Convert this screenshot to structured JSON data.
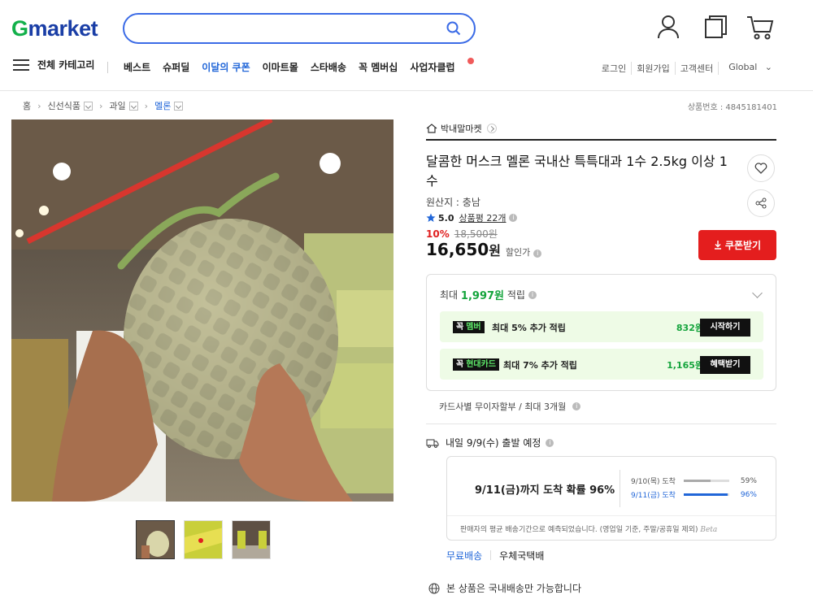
{
  "header": {
    "logo_g": "G",
    "logo_rest": "market",
    "search_placeholder": "",
    "category_label": "전체 카테고리",
    "nav": [
      "베스트",
      "슈퍼딜",
      "이달의 쿠폰",
      "이마트몰",
      "스타배송",
      "꼭 멤버십",
      "사업자클럽"
    ],
    "util": [
      "로그인",
      "회원가입",
      "고객센터",
      "Global"
    ]
  },
  "breadcrumb": [
    "홈",
    "신선식품",
    "과일",
    "멜론"
  ],
  "product_number": "상품번호 : 4845181401",
  "seller": "박내말마켓",
  "title": "달콤한 머스크 멜론 국내산 특특대과 1수 2.5kg 이상 1수",
  "origin": "원산지 : 충남",
  "rating": {
    "score": "5.0",
    "reviews": "상품평 22개"
  },
  "discount": {
    "percent": "10%",
    "original": "18,500원"
  },
  "price": {
    "amount": "16,650",
    "unit": "원",
    "label": "할인가"
  },
  "coupon_button": "쿠폰받기",
  "points": {
    "prefix": "최대",
    "amount": "1,997원",
    "suffix": "적립",
    "rows": [
      {
        "badge1": "꼭",
        "badge2": "멤버",
        "text": "최대 5% 추가 적립",
        "amount": "832원",
        "button": "시작하기"
      },
      {
        "badge1": "꼭",
        "badge2": "현대카드",
        "text": "최대 7% 추가 적립",
        "amount": "1,165원",
        "button": "혜택받기"
      }
    ]
  },
  "installment": "카드사별 무이자할부 / 최대 3개월",
  "shipping": {
    "dispatch": "내일 9/9(수) 출발 예정",
    "probability": "9/11(금)까지 도착 확률 96%",
    "bars": [
      {
        "label": "9/10(목) 도착",
        "percent": "59%",
        "value": 59
      },
      {
        "label": "9/11(금) 도착",
        "percent": "96%",
        "value": 96
      }
    ],
    "note": "판매자의 평균 배송기간으로 예측되었습니다. (영업일 기준, 주말/공휴일 제외)",
    "beta": "Beta"
  },
  "delivery": {
    "free": "무료배송",
    "carrier": "우체국택배"
  },
  "domestic_only": "본 상품은 국내배송만 가능합니다",
  "colors": {
    "brand_green": "#12b04a",
    "brand_blue": "#1a3ea6",
    "accent_blue": "#2166d8",
    "coupon_red": "#e41e1e",
    "point_green": "#14a43c"
  }
}
